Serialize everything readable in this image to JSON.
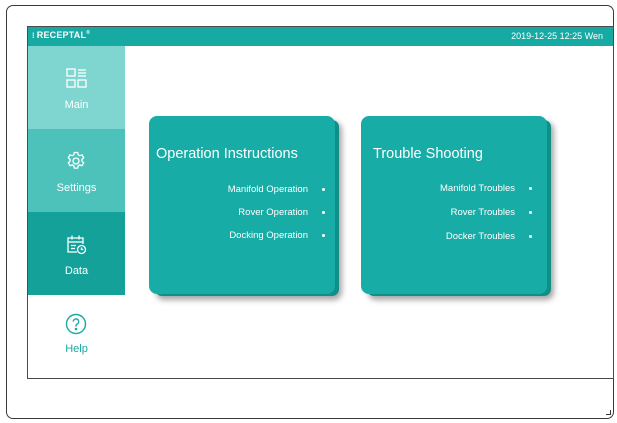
{
  "header": {
    "brand": "RECEPTAL",
    "brand_mark": "⁝",
    "brand_trademark": "®",
    "datetime": "2019-12-25 12:25 Wen",
    "background_color": "#17aaa3"
  },
  "sidebar": {
    "items": [
      {
        "label": "Main",
        "icon": "dashboard-grid-icon",
        "color": "#7fd5d0",
        "active": true
      },
      {
        "label": "Settings",
        "icon": "gear-icon",
        "color": "#4dc2bb"
      },
      {
        "label": "Data",
        "icon": "calendar-clock-icon",
        "color": "#14a19a"
      },
      {
        "label": "Help",
        "icon": "question-circle-icon",
        "color": "#ffffff"
      }
    ]
  },
  "cards": [
    {
      "title": "Operation Instructions",
      "links": [
        "Manifold Operation",
        "Rover Operation",
        "Docking Operation"
      ]
    },
    {
      "title": "Trouble Shooting",
      "links": [
        "Manifold Troubles",
        "Rover Troubles",
        "Docker Troubles"
      ]
    }
  ],
  "colors": {
    "accent": "#17aaa3",
    "card": "#17aca5",
    "card_shadow": "#0f8f88"
  }
}
